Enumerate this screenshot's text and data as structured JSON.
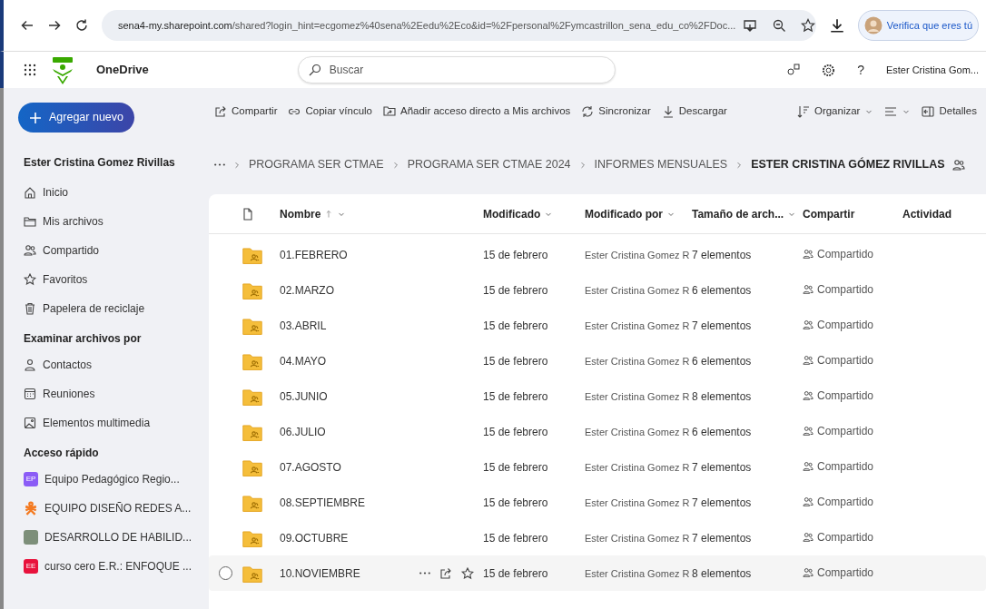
{
  "browser": {
    "url_host": "sena4-my.sharepoint.com",
    "url_path": "/shared?login_hint=ecgomez%40sena%2Eedu%2Eco&id=%2Fpersonal%2Fymcastrillon_sena_edu_co%2FDoc...",
    "profile_label": "Verifica que eres tú"
  },
  "app": {
    "name": "OneDrive",
    "search_placeholder": "Buscar",
    "help": "?",
    "user": "Ester Cristina Gom..."
  },
  "new_button": "Agregar nuevo",
  "sidebar": {
    "owner": "Ester Cristina Gomez Rivillas",
    "nav": [
      "Inicio",
      "Mis archivos",
      "Compartido",
      "Favoritos",
      "Papelera de reciclaje"
    ],
    "browse_heading": "Examinar archivos por",
    "browse": [
      "Contactos",
      "Reuniones",
      "Elementos multimedia"
    ],
    "quick_heading": "Acceso rápido",
    "quick": [
      {
        "label": "Equipo Pedagógico Regio...",
        "kind": "initials",
        "initials": "EP",
        "color": "#8b5cf6"
      },
      {
        "label": "EQUIPO DISEÑO REDES A...",
        "kind": "logo"
      },
      {
        "label": "DESARROLLO DE HABILID...",
        "kind": "photo"
      },
      {
        "label": "curso cero E.R.: ENFOQUE ...",
        "kind": "initials",
        "initials": "EE",
        "color": "#e8123c"
      }
    ]
  },
  "toolbar": {
    "left": [
      "Compartir",
      "Copiar vínculo",
      "Añadir acceso directo a Mis archivos",
      "Sincronizar",
      "Descargar"
    ],
    "right": [
      "Organizar",
      "Detalles"
    ]
  },
  "breadcrumb": [
    "PROGRAMA SER CTMAE",
    "PROGRAMA SER CTMAE 2024",
    "INFORMES MENSUALES",
    "ESTER CRISTINA GÓMEZ RIVILLAS"
  ],
  "table": {
    "columns": [
      {
        "label": "Nombre",
        "sorted": true,
        "menu": true
      },
      {
        "label": "Modificado",
        "sorted": false,
        "menu": true
      },
      {
        "label": "Modificado por",
        "sorted": false,
        "menu": true
      },
      {
        "label": "Tamaño de arch...",
        "sorted": false,
        "menu": true
      },
      {
        "label": "Compartir",
        "sorted": false,
        "menu": false
      },
      {
        "label": "Actividad",
        "sorted": false,
        "menu": false
      }
    ],
    "rows": [
      {
        "name": "01.FEBRERO",
        "modified": "15 de febrero",
        "modified_by": "Ester Cristina Gomez R",
        "size": "7 elementos",
        "sharing": "Compartido",
        "hovered": false
      },
      {
        "name": "02.MARZO",
        "modified": "15 de febrero",
        "modified_by": "Ester Cristina Gomez R",
        "size": "6 elementos",
        "sharing": "Compartido",
        "hovered": false
      },
      {
        "name": "03.ABRIL",
        "modified": "15 de febrero",
        "modified_by": "Ester Cristina Gomez R",
        "size": "7 elementos",
        "sharing": "Compartido",
        "hovered": false
      },
      {
        "name": "04.MAYO",
        "modified": "15 de febrero",
        "modified_by": "Ester Cristina Gomez R",
        "size": "6 elementos",
        "sharing": "Compartido",
        "hovered": false
      },
      {
        "name": "05.JUNIO",
        "modified": "15 de febrero",
        "modified_by": "Ester Cristina Gomez R",
        "size": "8 elementos",
        "sharing": "Compartido",
        "hovered": false
      },
      {
        "name": "06.JULIO",
        "modified": "15 de febrero",
        "modified_by": "Ester Cristina Gomez R",
        "size": "6 elementos",
        "sharing": "Compartido",
        "hovered": false
      },
      {
        "name": "07.AGOSTO",
        "modified": "15 de febrero",
        "modified_by": "Ester Cristina Gomez R",
        "size": "7 elementos",
        "sharing": "Compartido",
        "hovered": false
      },
      {
        "name": "08.SEPTIEMBRE",
        "modified": "15 de febrero",
        "modified_by": "Ester Cristina Gomez R",
        "size": "7 elementos",
        "sharing": "Compartido",
        "hovered": false
      },
      {
        "name": "09.OCTUBRE",
        "modified": "15 de febrero",
        "modified_by": "Ester Cristina Gomez R",
        "size": "7 elementos",
        "sharing": "Compartido",
        "hovered": false
      },
      {
        "name": "10.NOVIEMBRE",
        "modified": "15 de febrero",
        "modified_by": "Ester Cristina Gomez R",
        "size": "8 elementos",
        "sharing": "Compartido",
        "hovered": true
      }
    ]
  }
}
